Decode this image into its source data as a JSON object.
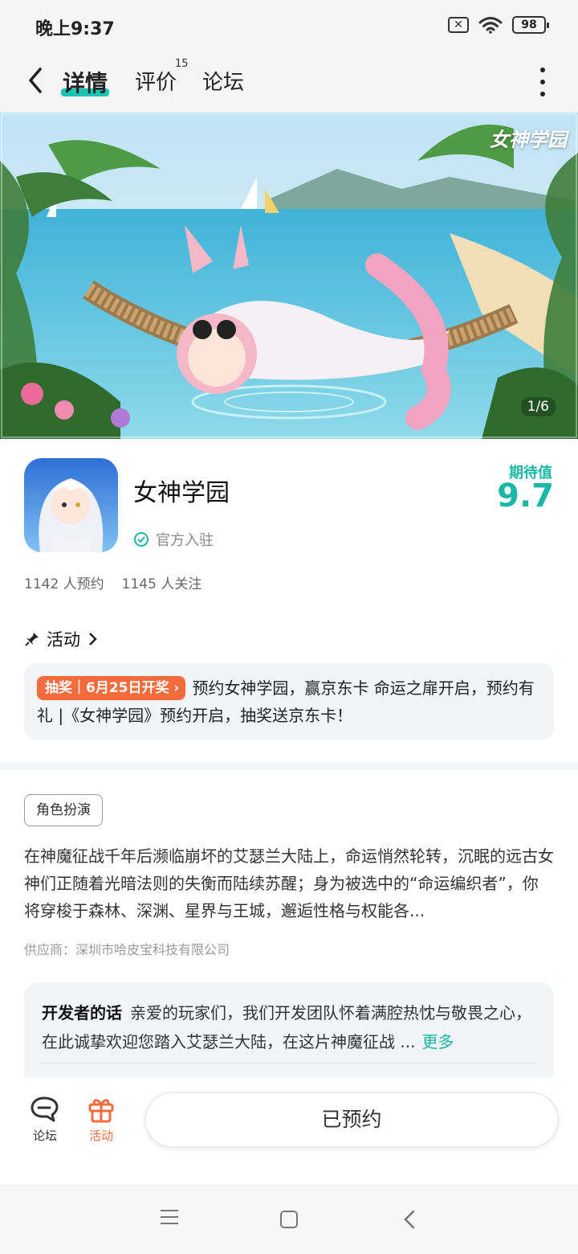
{
  "status_bar": {
    "time": "晚上9:37",
    "battery": "98"
  },
  "header": {
    "tabs": [
      {
        "label": "详情",
        "active": true
      },
      {
        "label": "评价",
        "badge": "15"
      },
      {
        "label": "论坛"
      }
    ]
  },
  "banner": {
    "title": "女神学园",
    "counter": "1/6"
  },
  "app": {
    "name": "女神学园",
    "official_label": "官方入驻",
    "expect_label": "期待值",
    "expect_value": "9.7",
    "reservations": "1142 人预约",
    "followers": "1145 人关注"
  },
  "activity": {
    "heading": "活动",
    "badge": "抽奖｜6月25日开奖",
    "text": "预约女神学园，赢京东卡 命运之扉开启，预约有礼 |《女神学园》预约开启，抽奖送京东卡！"
  },
  "description": {
    "tag": "角色扮演",
    "text": "在神魔征战千年后濒临崩坏的艾瑟兰大陆上，命运悄然轮转，沉眠的远古女神们正随着光暗法则的失衡而陆续苏醒；身为被选中的“命运编织者”，你将穿梭于森林、深渊、星界与王城，邂逅性格与权能各...",
    "supplier": "供应商：深圳市哈皮宝科技有限公司"
  },
  "developer": {
    "heading": "开发者的话",
    "text": "亲爱的玩家们，我们开发团队怀着满腔热忱与敬畏之心，在此诚挚欢迎您踏入艾瑟兰大陆，在这片神魔征战 ...",
    "more": "更多"
  },
  "bottom_bar": {
    "forum_label": "论坛",
    "activity_label": "活动",
    "reserved_label": "已预约"
  },
  "colors": {
    "accent": "#19b8a6",
    "orange": "#f46b3e"
  }
}
